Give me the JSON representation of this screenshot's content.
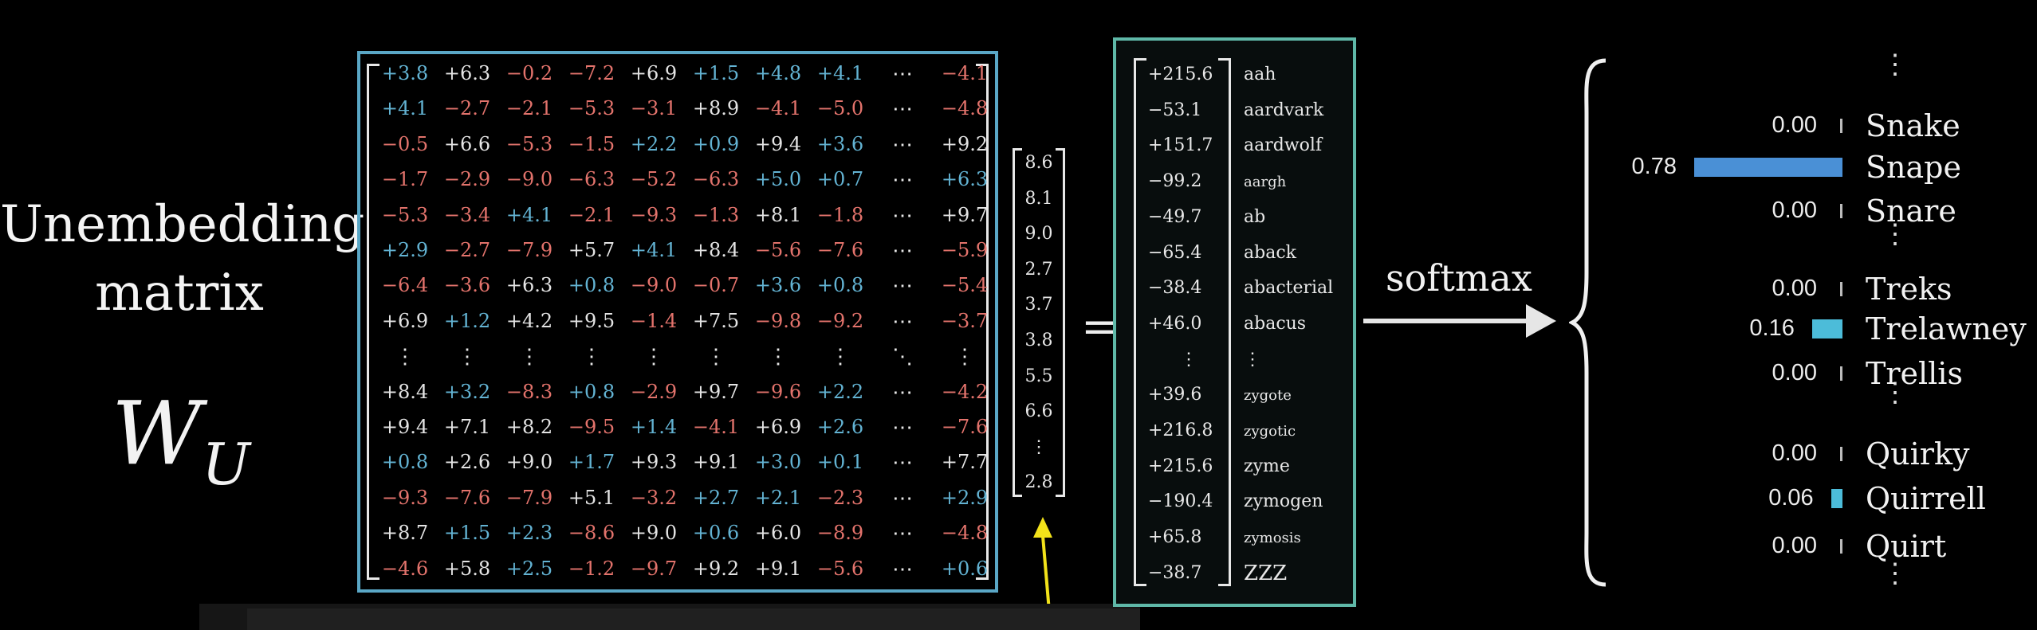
{
  "title": {
    "line1": "Unembedding",
    "line2": "matrix"
  },
  "symbol": {
    "base": "W",
    "sub": "U"
  },
  "matrix": {
    "rows": [
      [
        "+3.8",
        "+6.3",
        "−0.2",
        "−7.2",
        "+6.9",
        "+1.5",
        "+4.8",
        "+4.1",
        "⋯",
        "−4.1"
      ],
      [
        "+4.1",
        "−2.7",
        "−2.1",
        "−5.3",
        "−3.1",
        "+8.9",
        "−4.1",
        "−5.0",
        "⋯",
        "−4.8"
      ],
      [
        "−0.5",
        "+6.6",
        "−5.3",
        "−1.5",
        "+2.2",
        "+0.9",
        "+9.4",
        "+3.6",
        "⋯",
        "+9.2"
      ],
      [
        "−1.7",
        "−2.9",
        "−9.0",
        "−6.3",
        "−5.2",
        "−6.3",
        "+5.0",
        "+0.7",
        "⋯",
        "+6.3"
      ],
      [
        "−5.3",
        "−3.4",
        "+4.1",
        "−2.1",
        "−9.3",
        "−1.3",
        "+8.1",
        "−1.8",
        "⋯",
        "+9.7"
      ],
      [
        "+2.9",
        "−2.7",
        "−7.9",
        "+5.7",
        "+4.1",
        "+8.4",
        "−5.6",
        "−7.6",
        "⋯",
        "−5.9"
      ],
      [
        "−6.4",
        "−3.6",
        "+6.3",
        "+0.8",
        "−9.0",
        "−0.7",
        "+3.6",
        "+0.8",
        "⋯",
        "−5.4"
      ],
      [
        "+6.9",
        "+1.2",
        "+4.2",
        "+9.5",
        "−1.4",
        "+7.5",
        "−9.8",
        "−9.2",
        "⋯",
        "−3.7"
      ],
      [
        "⋮",
        "⋮",
        "⋮",
        "⋮",
        "⋮",
        "⋮",
        "⋮",
        "⋮",
        "⋱",
        "⋮"
      ],
      [
        "+8.4",
        "+3.2",
        "−8.3",
        "+0.8",
        "−2.9",
        "+9.7",
        "−9.6",
        "+2.2",
        "⋯",
        "−4.2"
      ],
      [
        "+9.4",
        "+7.1",
        "+8.2",
        "−9.5",
        "+1.4",
        "−4.1",
        "+6.9",
        "+2.6",
        "⋯",
        "−7.6"
      ],
      [
        "+0.8",
        "+2.6",
        "+9.0",
        "+1.7",
        "+9.3",
        "+9.1",
        "+3.0",
        "+0.1",
        "⋯",
        "+7.7"
      ],
      [
        "−9.3",
        "−7.6",
        "−7.9",
        "+5.1",
        "−3.2",
        "+2.7",
        "+2.1",
        "−2.3",
        "⋯",
        "+2.9"
      ],
      [
        "+8.7",
        "+1.5",
        "+2.3",
        "−8.6",
        "+9.0",
        "+0.6",
        "+6.0",
        "−8.9",
        "⋯",
        "−4.8"
      ],
      [
        "−4.6",
        "+5.8",
        "+2.5",
        "−1.2",
        "−9.7",
        "+9.2",
        "+9.1",
        "−5.6",
        "⋯",
        "+0.6"
      ]
    ],
    "colors": [
      [
        "b",
        "w",
        "r",
        "r",
        "w",
        "b",
        "b",
        "b",
        "d",
        "r"
      ],
      [
        "b",
        "r",
        "r",
        "r",
        "r",
        "w",
        "r",
        "r",
        "d",
        "r"
      ],
      [
        "r",
        "w",
        "r",
        "r",
        "b",
        "b",
        "w",
        "b",
        "d",
        "w"
      ],
      [
        "r",
        "r",
        "r",
        "r",
        "r",
        "r",
        "b",
        "b",
        "d",
        "b"
      ],
      [
        "r",
        "r",
        "b",
        "r",
        "r",
        "r",
        "w",
        "r",
        "d",
        "w"
      ],
      [
        "b",
        "r",
        "r",
        "w",
        "b",
        "w",
        "r",
        "r",
        "d",
        "r"
      ],
      [
        "r",
        "r",
        "w",
        "b",
        "r",
        "r",
        "b",
        "b",
        "d",
        "r"
      ],
      [
        "w",
        "b",
        "w",
        "w",
        "r",
        "w",
        "r",
        "r",
        "d",
        "r"
      ],
      [
        "d",
        "d",
        "d",
        "d",
        "d",
        "d",
        "d",
        "d",
        "d",
        "d"
      ],
      [
        "w",
        "b",
        "r",
        "b",
        "r",
        "w",
        "r",
        "b",
        "d",
        "r"
      ],
      [
        "w",
        "w",
        "w",
        "r",
        "b",
        "r",
        "w",
        "b",
        "d",
        "r"
      ],
      [
        "b",
        "w",
        "w",
        "b",
        "w",
        "w",
        "b",
        "b",
        "d",
        "w"
      ],
      [
        "r",
        "r",
        "r",
        "w",
        "r",
        "b",
        "b",
        "r",
        "d",
        "b"
      ],
      [
        "w",
        "b",
        "b",
        "r",
        "w",
        "b",
        "w",
        "r",
        "d",
        "r"
      ],
      [
        "r",
        "w",
        "b",
        "r",
        "r",
        "w",
        "w",
        "r",
        "d",
        "b"
      ]
    ]
  },
  "vector": [
    "8.6",
    "8.1",
    "9.0",
    "2.7",
    "3.7",
    "3.8",
    "5.5",
    "6.6",
    "⋮",
    "2.8"
  ],
  "equals": "=",
  "result": [
    {
      "value": "+215.6",
      "word": "aah"
    },
    {
      "value": "−53.1",
      "word": "aardvark"
    },
    {
      "value": "+151.7",
      "word": "aardwolf"
    },
    {
      "value": "−99.2",
      "word": "aargh"
    },
    {
      "value": "−49.7",
      "word": "ab"
    },
    {
      "value": "−65.4",
      "word": "aback"
    },
    {
      "value": "−38.4",
      "word": "abacterial"
    },
    {
      "value": "+46.0",
      "word": "abacus"
    },
    {
      "value": "⋮",
      "word": "⋮"
    },
    {
      "value": "+39.6",
      "word": "zygote"
    },
    {
      "value": "+216.8",
      "word": "zygotic"
    },
    {
      "value": "+215.6",
      "word": "zyme"
    },
    {
      "value": "−190.4",
      "word": "zymogen"
    },
    {
      "value": "+65.8",
      "word": "zymosis"
    },
    {
      "value": "−38.7",
      "word": "ZZZ"
    }
  ],
  "softmax_label": "softmax",
  "colors": {
    "matrix_border": "#5aa7c6",
    "result_border": "#5fb8a8",
    "bar_snape": "#4a90d6",
    "bar_other": "#4cbcd9",
    "arrow": "#f2e21a"
  },
  "probs": [
    {
      "prob": "0.00",
      "token": "Snake",
      "bar": 0.0
    },
    {
      "prob": "0.78",
      "token": "Snape",
      "bar": 0.78
    },
    {
      "prob": "0.00",
      "token": "Snare",
      "bar": 0.0
    },
    {
      "prob": "0.00",
      "token": "Treks",
      "bar": 0.0
    },
    {
      "prob": "0.16",
      "token": "Trelawney",
      "bar": 0.16
    },
    {
      "prob": "0.00",
      "token": "Trellis",
      "bar": 0.0
    },
    {
      "prob": "0.00",
      "token": "Quirky",
      "bar": 0.0
    },
    {
      "prob": "0.06",
      "token": "Quirrell",
      "bar": 0.06
    },
    {
      "prob": "0.00",
      "token": "Quirt",
      "bar": 0.0
    }
  ],
  "probs_ellipsis": "⋮"
}
